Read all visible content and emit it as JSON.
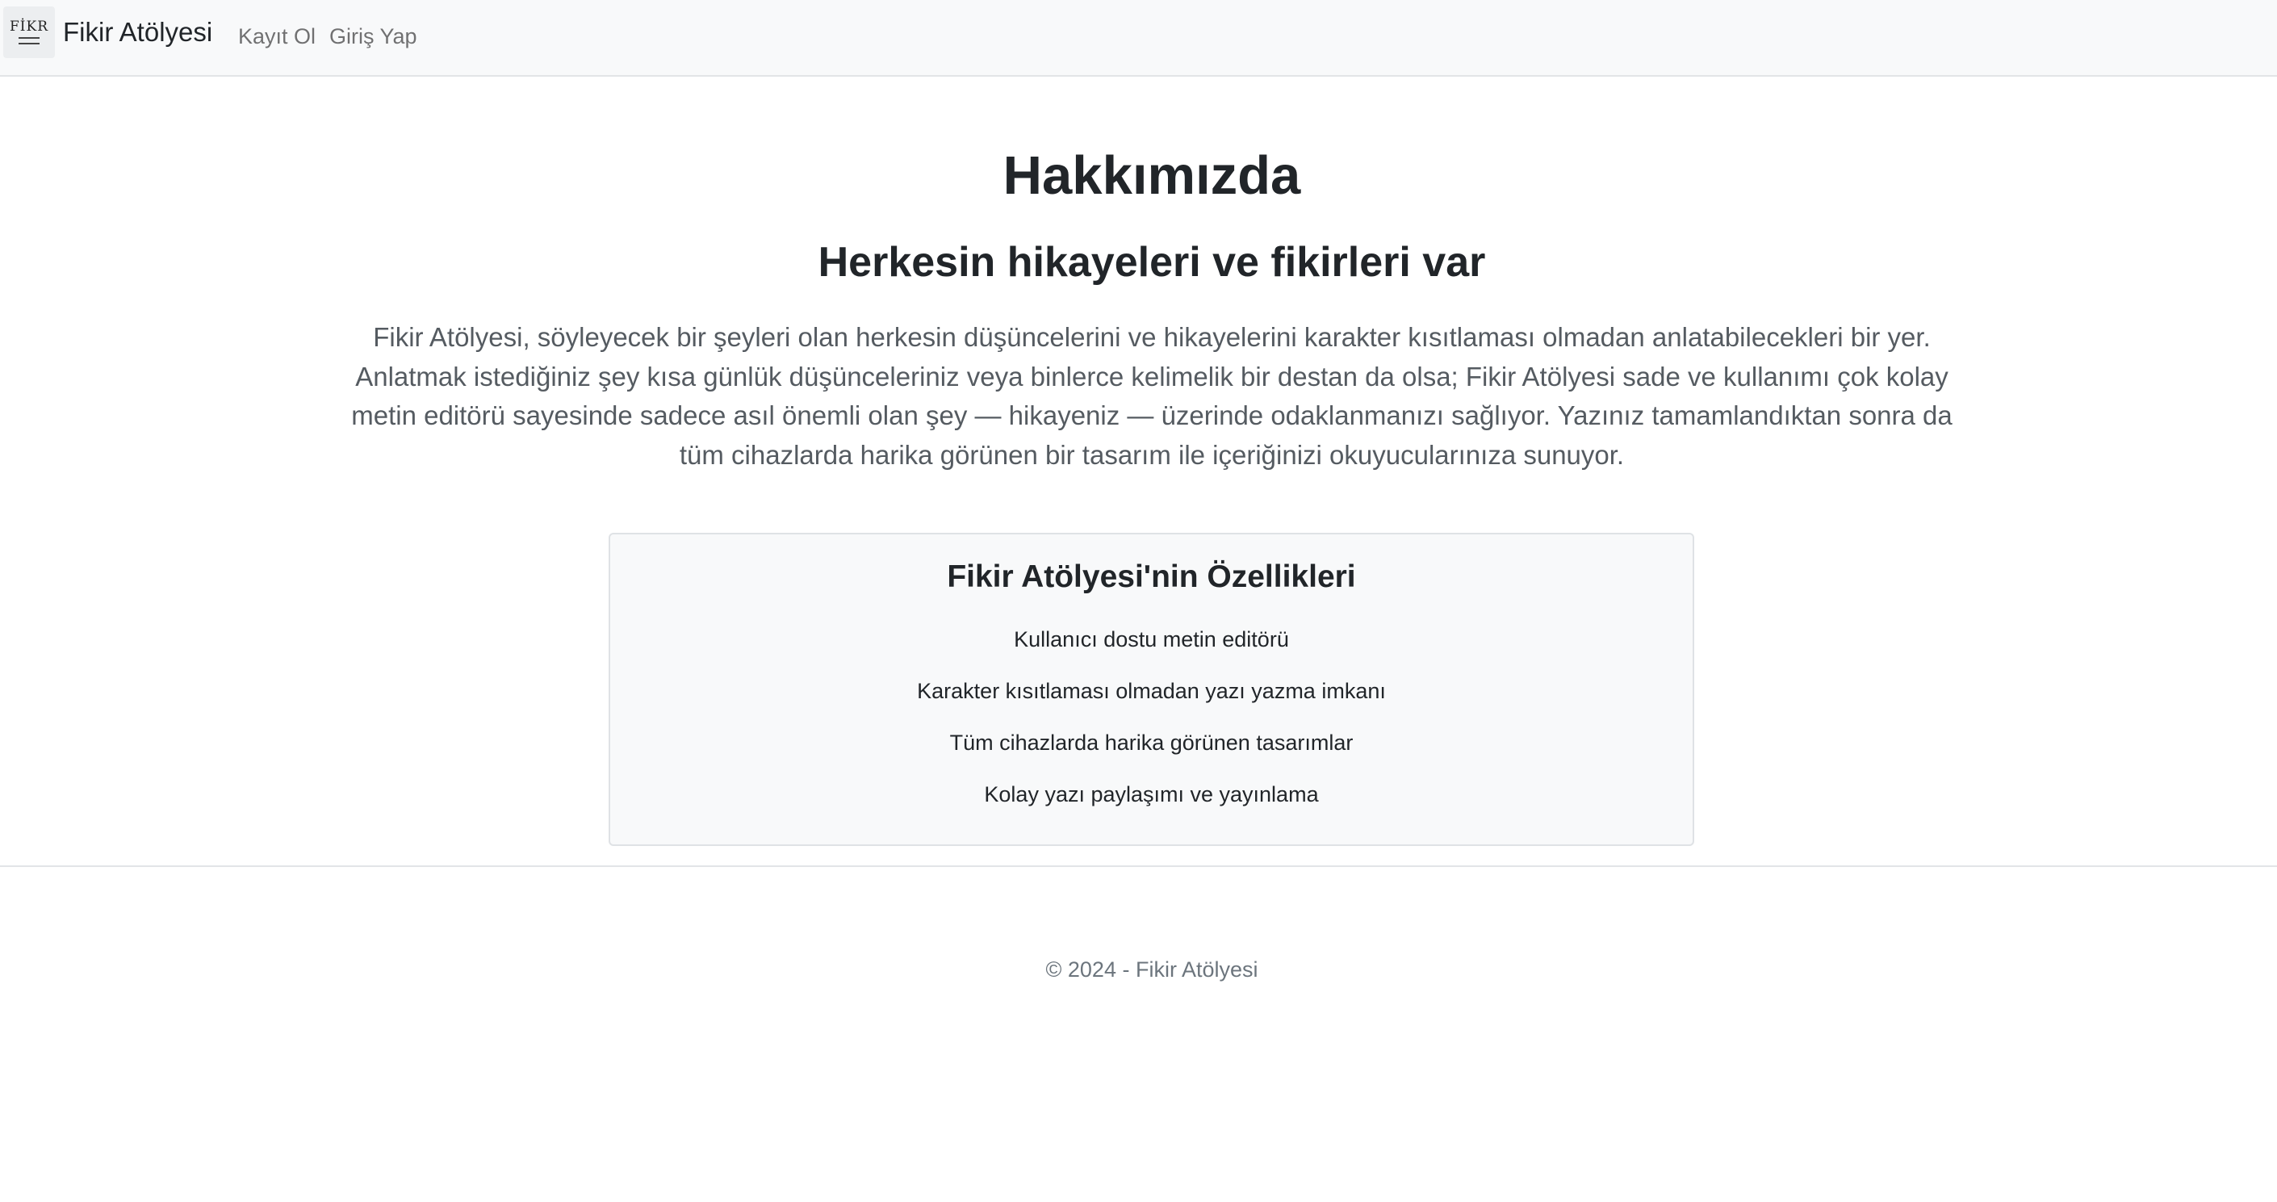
{
  "navbar": {
    "logo_text": "FİKR",
    "brand": "Fikir Atölyesi",
    "links": [
      {
        "label": "Kayıt Ol"
      },
      {
        "label": "Giriş Yap"
      }
    ]
  },
  "main": {
    "title": "Hakkımızda",
    "subtitle": "Herkesin hikayeleri ve fikirleri var",
    "description": "Fikir Atölyesi, söyleyecek bir şeyleri olan herkesin düşüncelerini ve hikayelerini karakter kısıtlaması olmadan anlatabilecekleri bir yer. Anlatmak istediğiniz şey kısa günlük düşünceleriniz veya binlerce kelimelik bir destan da olsa; Fikir Atölyesi sade ve kullanımı çok kolay metin editörü sayesinde sadece asıl önemli olan şey — hikayeniz — üzerinde odaklanmanızı sağlıyor. Yazınız tamamlandıktan sonra da tüm cihazlarda harika görünen bir tasarım ile içeriğinizi okuyucularınıza sunuyor.",
    "features": {
      "title": "Fikir Atölyesi'nin Özellikleri",
      "items": [
        "Kullanıcı dostu metin editörü",
        "Karakter kısıtlaması olmadan yazı yazma imkanı",
        "Tüm cihazlarda harika görünen tasarımlar",
        "Kolay yazı paylaşımı ve yayınlama"
      ]
    }
  },
  "footer": {
    "text": "© 2024 - Fikir Atölyesi"
  }
}
